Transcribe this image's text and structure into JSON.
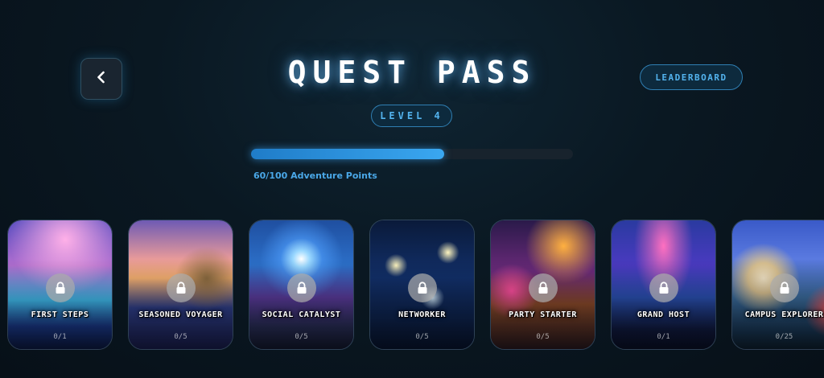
{
  "header": {
    "title": "QUEST PASS",
    "leaderboard_label": "LEADERBOARD",
    "back_icon": "chevron-left-icon"
  },
  "level": {
    "label": "LEVEL 4"
  },
  "progress": {
    "current": 60,
    "max": 100,
    "label": "60/100 Adventure Points"
  },
  "colors": {
    "accent": "#3aa7f0",
    "background": "#0a1822",
    "pill_border": "#2f7fb3"
  },
  "quests": [
    {
      "name": "FIRST STEPS",
      "progress": "0/1",
      "locked": true,
      "art": "sunset-city-runner"
    },
    {
      "name": "SEASONED VOYAGER",
      "progress": "0/5",
      "locked": true,
      "art": "sunset-traveler"
    },
    {
      "name": "SOCIAL CATALYST",
      "progress": "0/5",
      "locked": true,
      "art": "energy-orb-crowd"
    },
    {
      "name": "NETWORKER",
      "progress": "0/5",
      "locked": true,
      "art": "constellation-map"
    },
    {
      "name": "PARTY STARTER",
      "progress": "0/5",
      "locked": true,
      "art": "neon-party"
    },
    {
      "name": "GRAND HOST",
      "progress": "0/1",
      "locked": true,
      "art": "grand-hall-crowd"
    },
    {
      "name": "CAMPUS EXPLORER",
      "progress": "0/25",
      "locked": true,
      "art": "campus-dome"
    }
  ]
}
